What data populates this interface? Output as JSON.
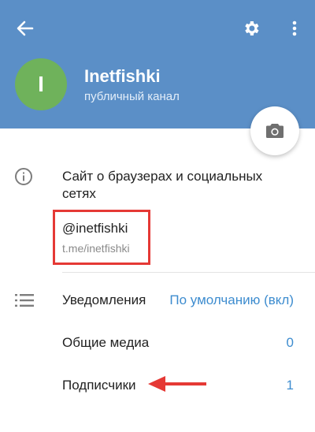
{
  "header": {
    "channel_name": "Inetfishki",
    "channel_type": "публичный канал",
    "avatar_letter": "I",
    "avatar_color": "#6fb25b",
    "background_color": "#5b8fc7",
    "icons": [
      "arrow-back-icon",
      "gear-icon",
      "more-vert-icon"
    ]
  },
  "camera": {
    "icon": "camera-icon"
  },
  "info": {
    "description": "Сайт о браузерах и социальных сетях",
    "username": "@inetfishki",
    "link": "t.me/inetfishki",
    "highlight_color": "#e53935"
  },
  "settings": {
    "notifications": {
      "label": "Уведомления",
      "value": "По умолчанию (вкл)"
    },
    "media": {
      "label": "Общие медиа",
      "value": "0"
    },
    "subscribers": {
      "label": "Подписчики",
      "value": "1"
    }
  }
}
